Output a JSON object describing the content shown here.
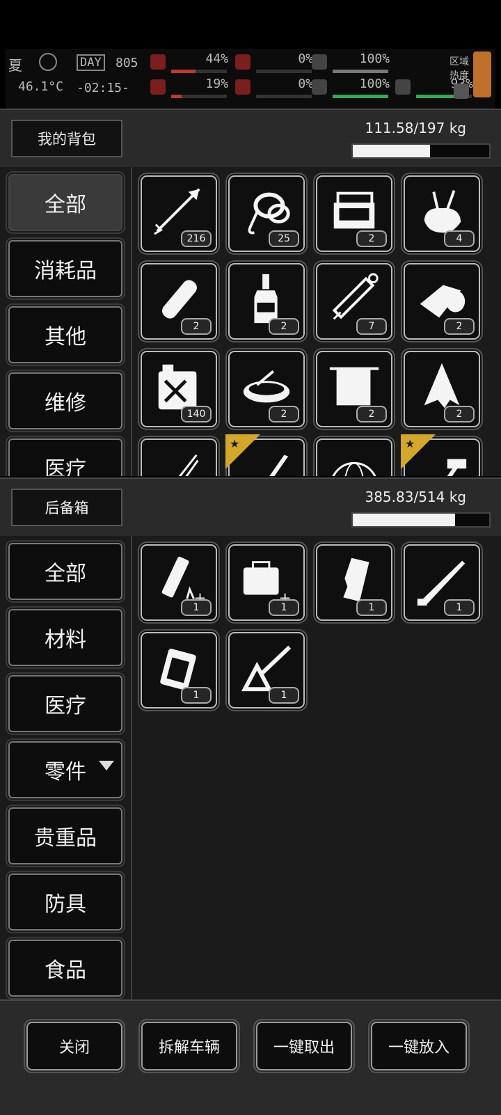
{
  "hud": {
    "season": "夏",
    "temperature": "46.1°C",
    "day_label": "DAY",
    "day_number": "805",
    "clock": "-02:15-",
    "stats": [
      {
        "icon": "medkit-icon",
        "value": "44%",
        "fill": 0.44,
        "color": "#c0392b"
      },
      {
        "icon": "heart-red-icon",
        "value": "19%",
        "fill": 0.19,
        "color": "#c0392b"
      },
      {
        "icon": "stomach-icon",
        "value": "0%",
        "fill": 0.0,
        "color": "#c0392b"
      },
      {
        "icon": "blood-drop-icon",
        "value": "0%",
        "fill": 0.0,
        "color": "#c0392b"
      },
      {
        "icon": "lungs-icon",
        "value": "100%",
        "fill": 1.0,
        "color": "#777777"
      },
      {
        "icon": "heart-icon",
        "value": "100%",
        "fill": 1.0,
        "color": "#3aa655"
      },
      {
        "icon": "radiation-icon",
        "value": "93%",
        "fill": 0.93,
        "color": "#3aa655"
      }
    ],
    "zone_label_1": "区域",
    "zone_label_2": "热度"
  },
  "backpack": {
    "title": "我的背包",
    "weight": "111.58/197 kg",
    "fill": 0.566,
    "tabs": [
      {
        "label": "全部",
        "active": true
      },
      {
        "label": "消耗品",
        "active": false
      },
      {
        "label": "其他",
        "active": false
      },
      {
        "label": "维修",
        "active": false
      },
      {
        "label": "医疗",
        "active": false
      }
    ],
    "items": [
      {
        "icon": "arrow-icon",
        "count": "216"
      },
      {
        "icon": "rope-icon",
        "count": "25"
      },
      {
        "icon": "toolbox-icon",
        "count": "2"
      },
      {
        "icon": "tool-bag-icon",
        "count": "4"
      },
      {
        "icon": "bandage-roll-icon",
        "count": "2"
      },
      {
        "icon": "liquor-bottle-icon",
        "count": "2"
      },
      {
        "icon": "syringe-icon",
        "count": "7"
      },
      {
        "icon": "gauze-roll-icon",
        "count": "2"
      },
      {
        "icon": "fuel-can-icon",
        "count": "140"
      },
      {
        "icon": "bowl-icon",
        "count": "2"
      },
      {
        "icon": "towel-icon",
        "count": "2"
      },
      {
        "icon": "torn-cloth-icon",
        "count": "2"
      },
      {
        "icon": "tweezers-icon",
        "count": ""
      },
      {
        "icon": "blade-icon",
        "count": "",
        "starred": true
      },
      {
        "icon": "globe-icon",
        "count": ""
      },
      {
        "icon": "axe-icon",
        "count": "",
        "starred": true
      }
    ]
  },
  "storage": {
    "title": "后备箱",
    "weight": "385.83/514 kg",
    "fill": 0.751,
    "tabs": [
      {
        "label": "全部",
        "active": false
      },
      {
        "label": "材料",
        "active": false
      },
      {
        "label": "医疗",
        "active": false
      },
      {
        "label": "零件",
        "active": false,
        "arrow": true
      },
      {
        "label": "贵重品",
        "active": false
      },
      {
        "label": "防具",
        "active": false
      },
      {
        "label": "食品",
        "active": false
      }
    ],
    "items": [
      {
        "icon": "magazine-upgrade-icon",
        "count": "1"
      },
      {
        "icon": "case-upgrade-icon",
        "count": "1"
      },
      {
        "icon": "grip-icon",
        "count": "1"
      },
      {
        "icon": "machete-icon",
        "count": "1"
      },
      {
        "icon": "pouch-icon",
        "count": "1"
      },
      {
        "icon": "crossbow-stock-icon",
        "count": "1"
      }
    ]
  },
  "footer": {
    "close": "关闭",
    "dismantle": "拆解车辆",
    "take_all": "一键取出",
    "put_all": "一键放入"
  }
}
